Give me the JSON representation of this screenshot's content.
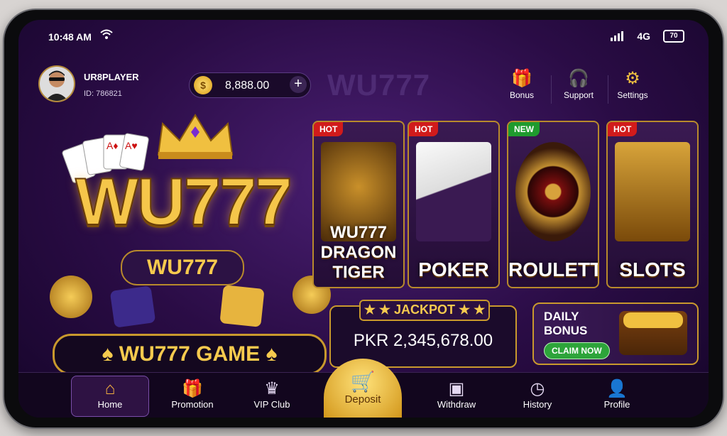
{
  "status": {
    "time": "10:48 AM",
    "network": "4G",
    "battery": "70"
  },
  "user": {
    "name": "UR8PLAYER",
    "id": "ID: 786821",
    "balance": "8,888.00"
  },
  "brand": {
    "watermark": "WU777",
    "title": "WU777",
    "sub": "WU777",
    "banner": "♠ WU777 GAME ♠"
  },
  "top_actions": [
    {
      "label": "Bonus",
      "icon": "gift-icon"
    },
    {
      "label": "Support",
      "icon": "headset-icon"
    },
    {
      "label": "Settings",
      "icon": "gear-icon"
    }
  ],
  "games": [
    {
      "tag": "HOT",
      "label": "WU777 DRAGON TIGER"
    },
    {
      "tag": "HOT",
      "label": "POKER"
    },
    {
      "tag": "NEW",
      "label": "ROULETTE"
    },
    {
      "tag": "HOT",
      "label": "SLOTS"
    }
  ],
  "jackpot": {
    "title": "★ ★ JACKPOT ★ ★",
    "value": "PKR 2,345,678.00"
  },
  "daily": {
    "title": "DAILY BONUS",
    "cta": "CLAIM NOW"
  },
  "nav": [
    {
      "label": "Home",
      "icon": "home-icon"
    },
    {
      "label": "Promotion",
      "icon": "gift-icon"
    },
    {
      "label": "VIP Club",
      "icon": "crown-icon"
    },
    {
      "label": "Deposit",
      "icon": "cart-icon"
    },
    {
      "label": "Withdraw",
      "icon": "atm-icon"
    },
    {
      "label": "History",
      "icon": "clock-icon"
    },
    {
      "label": "Profile",
      "icon": "user-icon"
    }
  ],
  "colors": {
    "accent": "#f6ca4e",
    "bg": "#2a0c45",
    "hot": "#d11b1b",
    "new": "#1f9b2e"
  }
}
